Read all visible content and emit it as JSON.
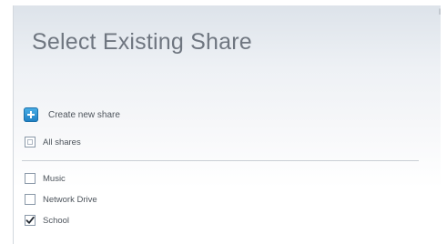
{
  "dialog": {
    "title": "Select Existing Share",
    "corner_mark": "l"
  },
  "create_share": {
    "label": "Create new share",
    "icon": "plus-icon",
    "icon_color": "#2a8fd4"
  },
  "all_shares": {
    "label": "All shares",
    "checked": false
  },
  "shares": [
    {
      "label": "Music",
      "checked": false
    },
    {
      "label": "Network Drive",
      "checked": false
    },
    {
      "label": "School",
      "checked": true
    }
  ]
}
